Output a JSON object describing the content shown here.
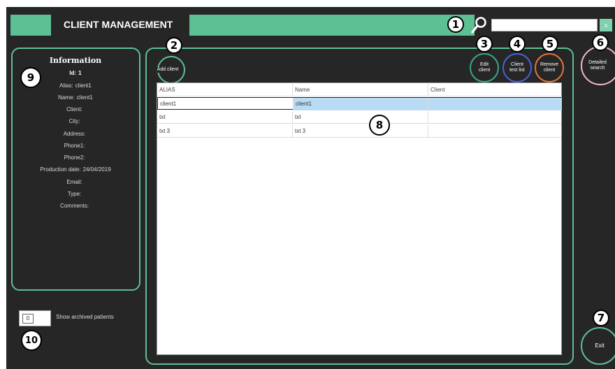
{
  "header": {
    "title": "CLIENT MANAGEMENT",
    "search_placeholder": "",
    "clear_label": "x"
  },
  "info": {
    "title": "Information",
    "rows": [
      {
        "label": "Id:",
        "value": "1"
      },
      {
        "label": "Alias:",
        "value": "client1"
      },
      {
        "label": "Name:",
        "value": "client1"
      },
      {
        "label": "Client:",
        "value": ""
      },
      {
        "label": "City:",
        "value": ""
      },
      {
        "label": "Address:",
        "value": ""
      },
      {
        "label": "Phone1:",
        "value": ""
      },
      {
        "label": "Phone2:",
        "value": ""
      },
      {
        "label": "Production date:",
        "value": "24/04/2019"
      },
      {
        "label": "Email:",
        "value": ""
      },
      {
        "label": "Type:",
        "value": ""
      },
      {
        "label": "Comments:",
        "value": ""
      }
    ]
  },
  "toolbar": {
    "add_client": "Add client",
    "edit_client": "Edit client",
    "client_test_list": "Client test list",
    "remove_client": "Remove client",
    "detailed_search": "Detailed search",
    "exit": "Exit"
  },
  "table": {
    "columns": [
      "ALIAS",
      "Name",
      "Client"
    ],
    "rows": [
      [
        "client1",
        "client1",
        ""
      ],
      [
        "txt",
        "txt",
        ""
      ],
      [
        "txt 3",
        "txt 3",
        ""
      ]
    ]
  },
  "archived": {
    "toggle_value": "0",
    "label": "Show archived patients"
  },
  "callouts": [
    "1",
    "2",
    "3",
    "4",
    "5",
    "6",
    "7",
    "8",
    "9",
    "10"
  ],
  "colors": {
    "accent": "#5dc095",
    "background": "#262626",
    "edit": "#3aa88a",
    "test_list": "#4a62d8",
    "remove": "#e2773a",
    "detailed": "#f2b8c2",
    "selected_row": "#b9dbf3"
  }
}
